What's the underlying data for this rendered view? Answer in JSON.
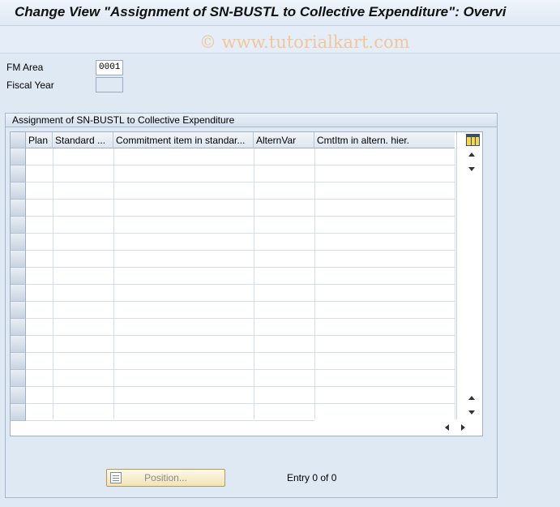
{
  "window": {
    "title": "Change View \"Assignment of SN-BUSTL to Collective Expenditure\": Overvi"
  },
  "watermark": "© www.tutorialkart.com",
  "fields": {
    "fm_area": {
      "label": "FM Area",
      "value": "0001"
    },
    "fiscal_year": {
      "label": "Fiscal Year",
      "value": ""
    }
  },
  "panel": {
    "title": "Assignment of SN-BUSTL to Collective Expenditure"
  },
  "table": {
    "columns": [
      "Plan",
      "Standard ...",
      "Commitment item in standar...",
      "AlternVar",
      "CmtItm in altern. hier."
    ]
  },
  "buttons": {
    "position_label": "Position..."
  },
  "status": {
    "entry": "Entry 0 of 0"
  },
  "icons": {
    "table_settings": "table-settings-icon",
    "position": "position-list-icon"
  }
}
